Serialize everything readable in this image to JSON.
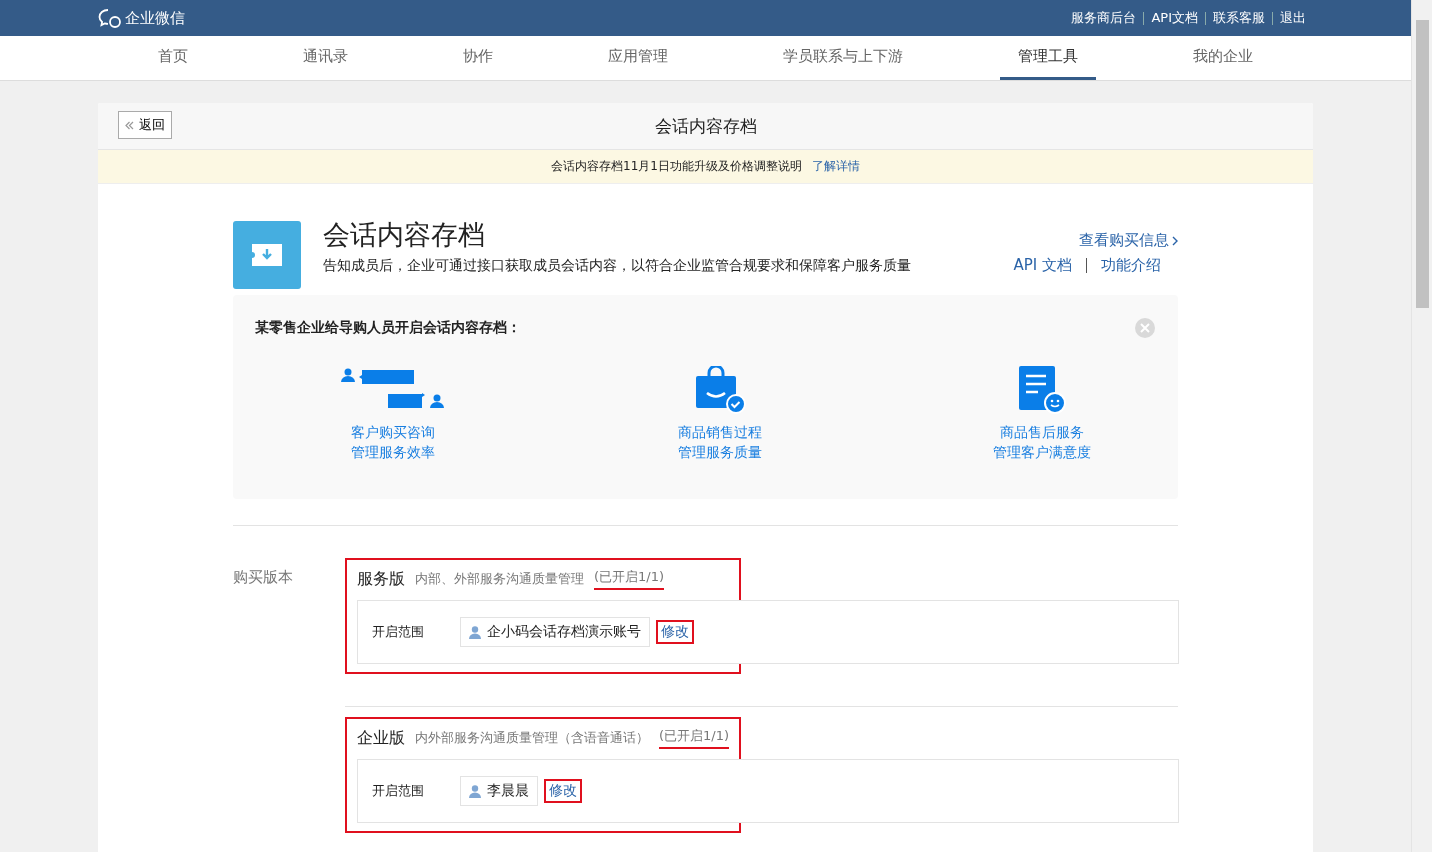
{
  "top_bar": {
    "logo": "企业微信",
    "links": [
      "服务商后台",
      "API文档",
      "联系客服",
      "退出"
    ]
  },
  "nav": [
    {
      "label": "首页",
      "selected": false
    },
    {
      "label": "通讯录",
      "selected": false
    },
    {
      "label": "协作",
      "selected": false
    },
    {
      "label": "应用管理",
      "selected": false
    },
    {
      "label": "学员联系与上下游",
      "selected": false
    },
    {
      "label": "管理工具",
      "selected": true
    },
    {
      "label": "我的企业",
      "selected": false
    }
  ],
  "card": {
    "back": "返回",
    "title": "会话内容存档",
    "notice": "会话内容存档11月1日功能升级及价格调整说明",
    "notice_link": "了解详情"
  },
  "app": {
    "name": "会话内容存档",
    "description": "告知成员后，企业可通过接口获取成员会话内容，以符合企业监管合规要求和保障客户服务质量",
    "purchase_link": "查看购买信息",
    "links": [
      "API 文档",
      "功能介绍"
    ]
  },
  "example": {
    "title": "某零售企业给导购人员开启会话内容存档：",
    "items": [
      {
        "kind": "chat",
        "line1": "客户购买咨询",
        "line2": "管理服务效率"
      },
      {
        "kind": "bag",
        "line1": "商品销售过程",
        "line2": "管理服务质量"
      },
      {
        "kind": "doc",
        "line1": "商品售后服务",
        "line2": "管理客户满意度"
      }
    ]
  },
  "purchase": {
    "label": "购买版本",
    "plans": [
      {
        "name": "服务版",
        "description": "内部、外部服务沟通质量管理",
        "status": "(已开启1/1)",
        "scope_label": "开启范围",
        "member": "企小码会话存档演示账号",
        "edit": "修改",
        "highlighted": true
      },
      {
        "name": "企业版",
        "description": "内外部服务沟通质量管理（含语音通话）",
        "status": "(已开启1/1)",
        "scope_label": "开启范围",
        "member": "李晨晨",
        "edit": "修改",
        "highlighted": true
      }
    ]
  }
}
